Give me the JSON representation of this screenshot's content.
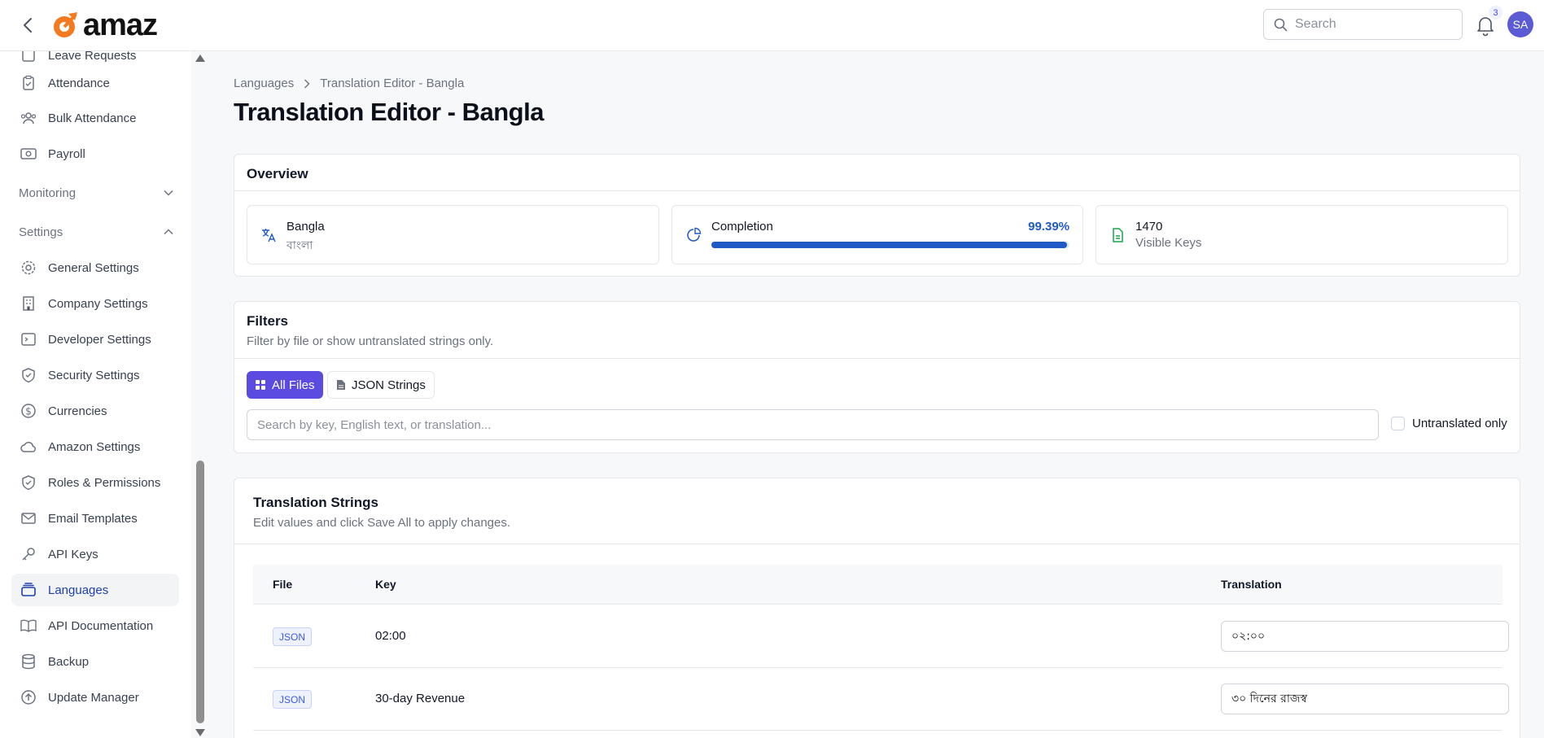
{
  "header": {
    "logo_text": "amaz",
    "search_placeholder": "Search",
    "notification_count": "3",
    "avatar_initials": "SA"
  },
  "sidebar": {
    "partial_item": "Leave Requests",
    "items_top": [
      {
        "label": "Attendance",
        "icon": "clipboard-icon"
      },
      {
        "label": "Bulk Attendance",
        "icon": "users-icon"
      },
      {
        "label": "Payroll",
        "icon": "money-icon"
      }
    ],
    "monitoring_label": "Monitoring",
    "settings_label": "Settings",
    "settings_items": [
      {
        "label": "General Settings",
        "icon": "gear-icon"
      },
      {
        "label": "Company Settings",
        "icon": "building-icon"
      },
      {
        "label": "Developer Settings",
        "icon": "terminal-icon"
      },
      {
        "label": "Security Settings",
        "icon": "shield-check-icon"
      },
      {
        "label": "Currencies",
        "icon": "dollar-icon"
      },
      {
        "label": "Amazon Settings",
        "icon": "cloud-icon"
      },
      {
        "label": "Roles & Permissions",
        "icon": "shield-check-icon"
      },
      {
        "label": "Email Templates",
        "icon": "mail-icon"
      },
      {
        "label": "API Keys",
        "icon": "key-icon"
      },
      {
        "label": "Languages",
        "icon": "layers-icon",
        "active": true
      },
      {
        "label": "API Documentation",
        "icon": "book-icon"
      },
      {
        "label": "Backup",
        "icon": "database-icon"
      },
      {
        "label": "Update Manager",
        "icon": "upload-icon"
      }
    ],
    "accent_color": "#1e40af"
  },
  "breadcrumb": {
    "parent": "Languages",
    "current": "Translation Editor - Bangla"
  },
  "page_title": "Translation Editor - Bangla",
  "overview": {
    "title": "Overview",
    "language_name": "Bangla",
    "language_native": "বাংলা",
    "completion_label": "Completion",
    "completion_percent_text": "99.39%",
    "completion_value": 99.39,
    "visible_keys_count": "1470",
    "visible_keys_label": "Visible Keys"
  },
  "filters": {
    "title": "Filters",
    "subtitle": "Filter by file or show untranslated strings only.",
    "all_files_label": "All Files",
    "json_strings_label": "JSON Strings",
    "search_placeholder": "Search by key, English text, or translation...",
    "untranslated_label": "Untranslated only",
    "primary_color": "#5b4be0"
  },
  "translations": {
    "title": "Translation Strings",
    "subtitle": "Edit values and click Save All to apply changes.",
    "columns": {
      "file": "File",
      "key": "Key",
      "translation": "Translation"
    },
    "rows": [
      {
        "file": "JSON",
        "key": "02:00",
        "translation": "০২:০০"
      },
      {
        "file": "JSON",
        "key": "30-day Revenue",
        "translation": "৩০ দিনের রাজস্ব"
      }
    ]
  }
}
